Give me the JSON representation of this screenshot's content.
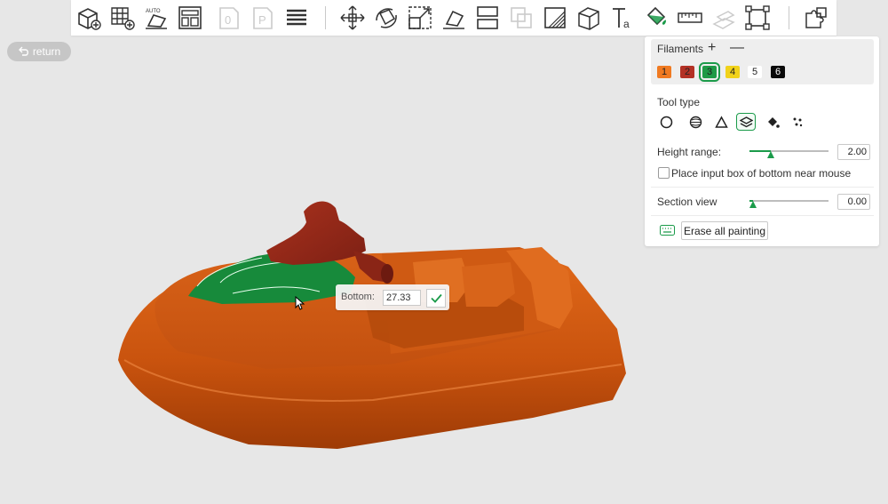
{
  "toolbar": {
    "buttons": [
      {
        "name": "add-object",
        "icon": "cube-plus-icon",
        "enabled": true
      },
      {
        "name": "add-plate",
        "icon": "grid-plus-icon",
        "enabled": true
      },
      {
        "name": "auto-orient",
        "icon": "auto-orient-icon",
        "enabled": true
      },
      {
        "name": "arrange",
        "icon": "arrange-icon",
        "enabled": true
      },
      {
        "name": "slice-plate",
        "icon": "plate-0-icon",
        "enabled": false
      },
      {
        "name": "plate-p",
        "icon": "plate-p-icon",
        "enabled": false
      },
      {
        "name": "layers",
        "icon": "layers-icon",
        "enabled": true
      },
      {
        "name": "move",
        "icon": "move-icon",
        "enabled": true
      },
      {
        "name": "rotate",
        "icon": "rotate-icon",
        "enabled": true
      },
      {
        "name": "scale",
        "icon": "scale-icon",
        "enabled": true
      },
      {
        "name": "lay-on-face",
        "icon": "lay-on-face-icon",
        "enabled": true
      },
      {
        "name": "cut",
        "icon": "cut-icon",
        "enabled": true
      },
      {
        "name": "boolean",
        "icon": "boolean-icon",
        "enabled": false
      },
      {
        "name": "support-paint",
        "icon": "support-paint-icon",
        "enabled": true
      },
      {
        "name": "seam-paint",
        "icon": "seam-cube-icon",
        "enabled": true
      },
      {
        "name": "text",
        "icon": "text-icon",
        "enabled": true
      },
      {
        "name": "color-paint",
        "icon": "paint-bucket-icon",
        "enabled": true
      },
      {
        "name": "measure",
        "icon": "ruler-icon",
        "enabled": true
      },
      {
        "name": "assembly",
        "icon": "assembly-icon",
        "enabled": false
      },
      {
        "name": "simplify",
        "icon": "frame-icon",
        "enabled": true
      },
      {
        "name": "variable-layer",
        "icon": "puzzle-icon",
        "enabled": true
      }
    ]
  },
  "return_label": "return",
  "panel": {
    "filaments_title": "Filaments",
    "add_symbol": "+",
    "remove_symbol": "—",
    "filaments": [
      {
        "label": "1",
        "color": "#f07a21",
        "text_color": "#222222",
        "selected": false
      },
      {
        "label": "2",
        "color": "#b33125",
        "text_color": "#222222",
        "selected": false
      },
      {
        "label": "3",
        "color": "#1e9a46",
        "text_color": "#222222",
        "selected": true
      },
      {
        "label": "4",
        "color": "#f1d21a",
        "text_color": "#222222",
        "selected": false
      },
      {
        "label": "5",
        "color": "#ffffff",
        "text_color": "#222222",
        "selected": false
      },
      {
        "label": "6",
        "color": "#0a0a0a",
        "text_color": "#ffffff",
        "selected": false
      }
    ],
    "tool_type_label": "Tool type",
    "tools": [
      {
        "icon": "circle-tool-icon",
        "active": false
      },
      {
        "icon": "sphere-tool-icon",
        "active": false
      },
      {
        "icon": "triangle-tool-icon",
        "active": false
      },
      {
        "icon": "height-range-tool-icon",
        "active": true
      },
      {
        "icon": "fill-tool-icon",
        "active": false
      },
      {
        "icon": "gap-fill-tool-icon",
        "active": false
      }
    ],
    "height_range_label": "Height range:",
    "height_range_value": "2.00",
    "height_range_fraction": 0.27,
    "bottom_near_mouse_label": "Place input box of bottom near mouse",
    "bottom_near_mouse_checked": false,
    "section_view_label": "Section view",
    "section_view_value": "0.00",
    "section_view_fraction": 0.05,
    "erase_all_label": "Erase all painting"
  },
  "popup": {
    "bottom_label": "Bottom:",
    "bottom_value": "27.33"
  },
  "colors": {
    "accent": "#1b9b4a",
    "hull": "#d45d12",
    "seat": "#8f2518",
    "painted": "#178a3b",
    "background": "#e7e7e7"
  }
}
